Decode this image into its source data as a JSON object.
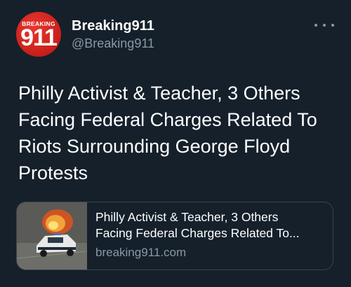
{
  "author": {
    "avatar_text_top": "BREAKING",
    "avatar_text_main": "911",
    "display_name": "Breaking911",
    "handle": "@Breaking911"
  },
  "tweet": {
    "text": "Philly Activist & Teacher, 3 Others Facing Federal Charges Related To Riots Surrounding George Floyd Protests"
  },
  "link_card": {
    "title_line1": "Philly Activist & Teacher, 3 Others",
    "title_line2": "Facing Federal Charges Related To...",
    "domain": "breaking911.com",
    "thumbnail_icon": "burning-police-car-image"
  },
  "icons": {
    "more": "more-horizontal-icon"
  },
  "colors": {
    "background": "#15202b",
    "secondary_text": "#8b98a5",
    "brand_red": "#c81f1a",
    "border": "#38444d"
  }
}
